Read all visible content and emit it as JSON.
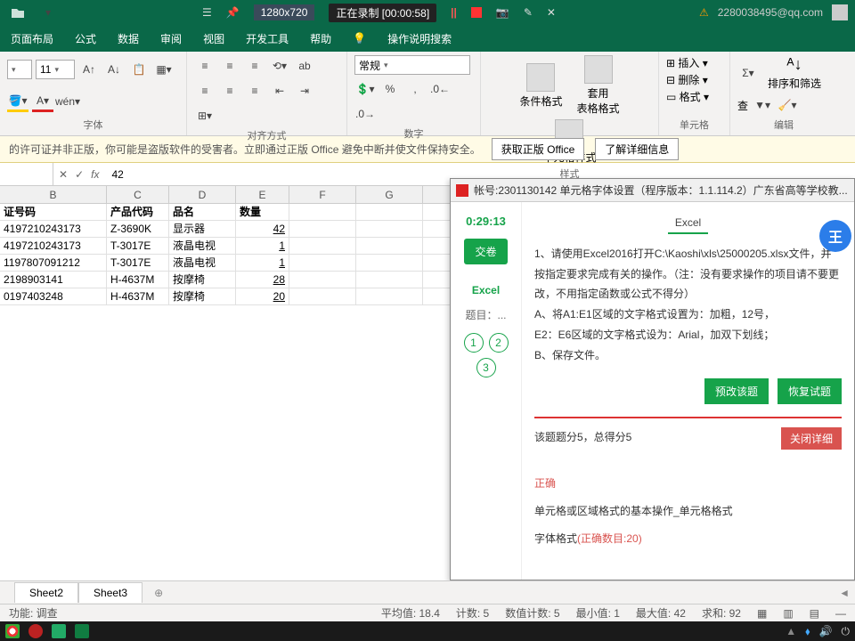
{
  "titlebar": {
    "resolution": "1280x720",
    "recording": "正在录制 [00:00:58]",
    "email": "2280038495@qq.com",
    "warn_icon": "⚠"
  },
  "tabs": {
    "layout": "页面布局",
    "formula": "公式",
    "data": "数据",
    "review": "审阅",
    "view": "视图",
    "dev": "开发工具",
    "help": "帮助",
    "tellme": "操作说明搜索"
  },
  "ribbon": {
    "font_size": "11",
    "num_format": "常规",
    "groups": {
      "font": "字体",
      "align": "对齐方式",
      "number": "数字",
      "styles": "样式",
      "cells": "单元格",
      "editing": "编辑"
    },
    "big": {
      "cond": "条件格式",
      "tablefmt": "套用\n表格格式",
      "cellfmt": "单元格样式",
      "sort": "排序和筛选",
      "find": "查"
    },
    "menu": {
      "insert": "插入",
      "delete": "删除",
      "format": "格式"
    }
  },
  "warning": {
    "text": "的许可证并非正版，你可能是盗版软件的受害者。立即通过正版 Office 避免中断并使文件保持安全。",
    "btn1": "获取正版 Office",
    "btn2": "了解详细信息"
  },
  "formula": {
    "fx": "fx",
    "value": "42"
  },
  "headers": {
    "B": "证号码",
    "C": "产品代码",
    "D": "品名",
    "E": "数量"
  },
  "rows": [
    {
      "b": "4197210243173",
      "c": "Z-3690K",
      "d": "显示器",
      "e": "42"
    },
    {
      "b": "4197210243173",
      "c": "T-3017E",
      "d": "液晶电视",
      "e": "1"
    },
    {
      "b": "1197807091212",
      "c": "T-3017E",
      "d": "液晶电视",
      "e": "1"
    },
    {
      "b": "2198903141",
      "c": "H-4637M",
      "d": "按摩椅",
      "e": "28"
    },
    {
      "b": "0197403248",
      "c": "H-4637M",
      "d": "按摩椅",
      "e": "20"
    }
  ],
  "sheets": {
    "s2": "Sheet2",
    "s3": "Sheet3"
  },
  "status": {
    "ready": "功能: 调查",
    "avg": "平均值: 18.4",
    "count": "计数: 5",
    "numcount": "数值计数: 5",
    "min": "最小值: 1",
    "max": "最大值: 42",
    "sum": "求和: 92"
  },
  "exam": {
    "title": "帐号:2301130142  单元格字体设置（程序版本：1.1.114.2）广东省高等学校教...",
    "tab": "Excel",
    "timer": "0:29:13",
    "submit": "交卷",
    "section": "Excel",
    "subject": "题目：...",
    "q": [
      "1",
      "2",
      "3"
    ],
    "body1": "1、请使用Excel2016打开C:\\Kaoshi\\xls\\25000205.xlsx文件，并按指定要求完成有关的操作。（注：没有要求操作的项目请不要更改，不用指定函数或公式不得分）",
    "body2": "A、将A1:E1区域的文字格式设置为：加粗，12号，",
    "body3": "E2：E6区域的文字格式设为：Arial，加双下划线；",
    "body4": "B、保存文件。",
    "btn_pregrade": "预改该题",
    "btn_restore": "恢复试题",
    "score": "该题题分5，总得分5",
    "close": "关闭详细",
    "correct": "正确",
    "detail1": "单元格或区域格式的基本操作_单元格格式",
    "detail2a": "字体格式",
    "detail2b": "(正确数目:20)"
  },
  "fab": "王"
}
